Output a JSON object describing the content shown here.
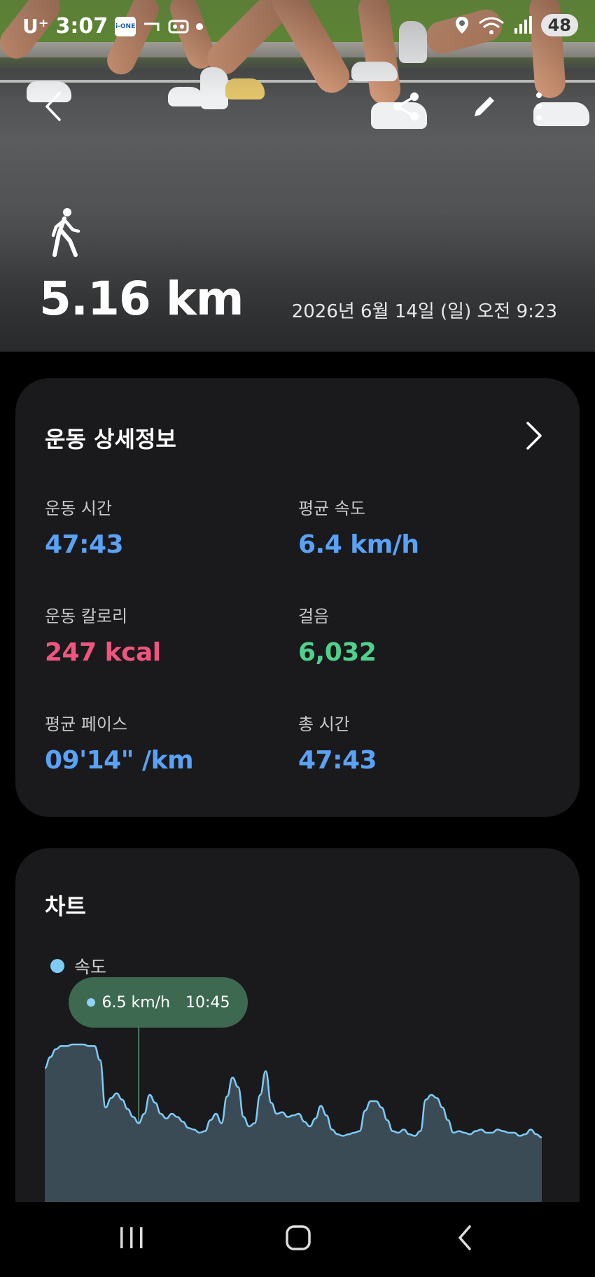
{
  "status": {
    "carrier": "U⁺",
    "time": "3:07",
    "app_badge": "i-ONE",
    "battery": "48"
  },
  "hero": {
    "distance": "5.16 km",
    "datetime": "2026년 6월 14일 (일) 오전 9:23",
    "activity_icon": "walking-icon"
  },
  "detail": {
    "title": "운동 상세정보",
    "metrics": [
      {
        "label": "운동 시간",
        "value": "47:43",
        "color": "#5aa2f5"
      },
      {
        "label": "평균 속도",
        "value": "6.4 km/h",
        "color": "#5aa2f5"
      },
      {
        "label": "운동 칼로리",
        "value": "247 kcal",
        "color": "#f1557f"
      },
      {
        "label": "걸음",
        "value": "6,032",
        "color": "#4fd08b"
      },
      {
        "label": "평균 페이스",
        "value": "09'14\" /km",
        "color": "#5aa2f5"
      },
      {
        "label": "총 시간",
        "value": "47:43",
        "color": "#5aa2f5"
      }
    ]
  },
  "chart": {
    "title": "차트",
    "legend": "속도",
    "tooltip_value": "6.5 km/h",
    "tooltip_time": "10:45"
  },
  "chart_data": {
    "type": "area",
    "title": "",
    "series": [
      {
        "name": "속도",
        "color": "#7ecbf5"
      }
    ],
    "values": [
      8.5,
      9.2,
      9.7,
      9.9,
      9.9,
      10.0,
      10.0,
      10.0,
      9.9,
      9.9,
      9.0,
      6.0,
      6.6,
      6.9,
      6.5,
      5.9,
      5.4,
      5.0,
      5.6,
      6.8,
      6.3,
      5.6,
      5.3,
      5.6,
      5.4,
      5.1,
      4.7,
      4.6,
      4.4,
      4.5,
      5.2,
      5.6,
      5.0,
      6.7,
      7.9,
      7.3,
      5.4,
      4.8,
      5.0,
      6.8,
      8.3,
      6.3,
      5.6,
      5.7,
      5.4,
      5.5,
      5.6,
      5.1,
      4.8,
      5.3,
      6.1,
      5.5,
      4.6,
      4.3,
      4.2,
      4.3,
      4.4,
      4.5,
      5.8,
      6.4,
      6.4,
      6.0,
      5.2,
      4.5,
      4.4,
      4.6,
      4.3,
      4.2,
      4.5,
      6.5,
      6.8,
      6.6,
      6.0,
      5.2,
      4.4,
      4.5,
      4.4,
      4.3,
      4.5,
      4.6,
      4.4,
      4.4,
      4.6,
      4.5,
      4.4,
      4.4,
      4.2,
      4.3,
      4.6,
      4.3,
      4.1
    ],
    "tooltip_index": 17,
    "fill_color": "#3b4b56"
  },
  "nav": {
    "recent": "recent-apps-icon",
    "home": "home-icon",
    "back": "back-icon"
  }
}
